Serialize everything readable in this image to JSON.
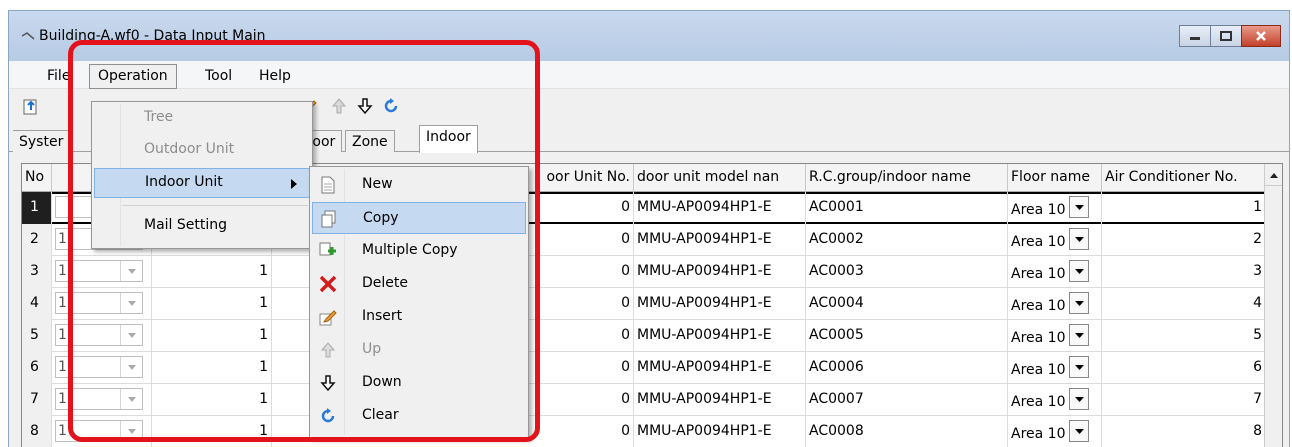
{
  "window": {
    "title": "Building-A.wf0 - Data Input Main"
  },
  "menubar": {
    "file": "File",
    "operation": "Operation",
    "tool": "Tool",
    "help": "Help"
  },
  "tabs": {
    "system": "Syster",
    "outdoor": "tdoor",
    "zone": "Zone",
    "indoor": "Indoor"
  },
  "operation_menu": {
    "items": [
      {
        "label": "Tree",
        "disabled": true
      },
      {
        "label": "Outdoor Unit",
        "disabled": true
      },
      {
        "label": "Indoor Unit",
        "disabled": false,
        "submenu": true
      },
      {
        "label": "Mail Setting",
        "disabled": false
      }
    ]
  },
  "indoor_submenu": {
    "items": [
      {
        "label": "New",
        "icon": "new-icon"
      },
      {
        "label": "Copy",
        "icon": "copy-icon"
      },
      {
        "label": "Multiple Copy",
        "icon": "multiple-copy-icon"
      },
      {
        "label": "Delete",
        "icon": "delete-icon"
      },
      {
        "label": "Insert",
        "icon": "insert-icon"
      },
      {
        "label": "Up",
        "icon": "up-arrow-icon",
        "disabled": true
      },
      {
        "label": "Down",
        "icon": "down-arrow-icon"
      },
      {
        "label": "Clear",
        "icon": "clear-icon"
      }
    ]
  },
  "grid": {
    "headers": [
      "No",
      "oor Unit No.",
      "door unit model nan",
      "R.C.group/indoor name",
      "Floor name",
      "Air Conditioner No."
    ],
    "rows": [
      {
        "no": "1",
        "c1": "",
        "c2": "",
        "unitno": "0",
        "model": "MMU-AP0094HP1-E",
        "name": "AC0001",
        "floor": "Area 10",
        "acno": "1"
      },
      {
        "no": "2",
        "c1": "1",
        "c2": "1",
        "unitno": "0",
        "model": "MMU-AP0094HP1-E",
        "name": "AC0002",
        "floor": "Area 10",
        "acno": "2"
      },
      {
        "no": "3",
        "c1": "1",
        "c2": "1",
        "unitno": "0",
        "model": "MMU-AP0094HP1-E",
        "name": "AC0003",
        "floor": "Area 10",
        "acno": "3"
      },
      {
        "no": "4",
        "c1": "1",
        "c2": "1",
        "unitno": "0",
        "model": "MMU-AP0094HP1-E",
        "name": "AC0004",
        "floor": "Area 10",
        "acno": "4"
      },
      {
        "no": "5",
        "c1": "1",
        "c2": "1",
        "unitno": "0",
        "model": "MMU-AP0094HP1-E",
        "name": "AC0005",
        "floor": "Area 10",
        "acno": "5"
      },
      {
        "no": "6",
        "c1": "1",
        "c2": "1",
        "unitno": "0",
        "model": "MMU-AP0094HP1-E",
        "name": "AC0006",
        "floor": "Area 10",
        "acno": "6"
      },
      {
        "no": "7",
        "c1": "1",
        "c2": "1",
        "unitno": "0",
        "model": "MMU-AP0094HP1-E",
        "name": "AC0007",
        "floor": "Area 10",
        "acno": "7"
      },
      {
        "no": "8",
        "c1": "1",
        "c2": "1",
        "unitno": "0",
        "model": "MMU-AP0094HP1-E",
        "name": "AC0008",
        "floor": "Area 10",
        "acno": "8"
      }
    ]
  },
  "highlight_color": "#e4121b"
}
